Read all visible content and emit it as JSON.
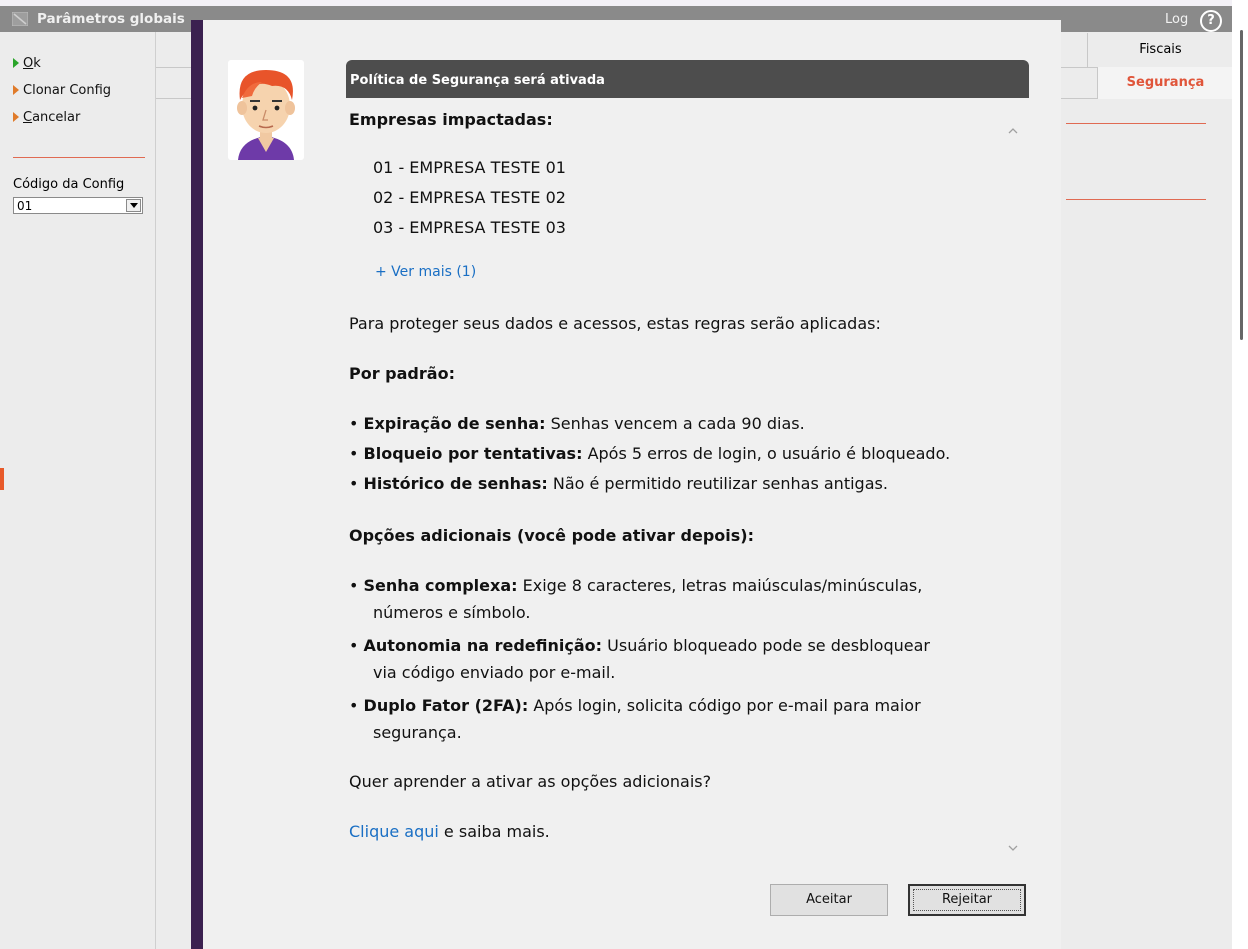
{
  "app": {
    "title": "Parâmetros globais",
    "log_label": "Log",
    "help_icon": "help-icon",
    "actions": [
      {
        "label": "Ok",
        "mnemonic": "O",
        "rest": "k",
        "icon": "green-triangle-icon"
      },
      {
        "label": "Clonar Config",
        "mnemonic": "",
        "rest": "Clonar Config",
        "icon": "orange-triangle-icon"
      },
      {
        "label": "Cancelar",
        "mnemonic": "C",
        "rest": "ancelar",
        "icon": "orange-triangle-icon"
      }
    ],
    "config_code_label": "Código da Config",
    "config_code_value": "01",
    "tabs": {
      "fiscais": "Fiscais",
      "seguranca": "Segurança"
    }
  },
  "dialog": {
    "title": "Política de Segurança será ativada",
    "companies_heading": "Empresas impactadas:",
    "companies": [
      "01 - EMPRESA TESTE 01",
      "02 - EMPRESA TESTE 02",
      "03 - EMPRESA TESTE 03"
    ],
    "see_more": "+ Ver mais (1)",
    "intro": "Para proteger seus dados e acessos, estas regras serão aplicadas:",
    "default_heading": "Por padrão:",
    "default_rules": [
      {
        "term": "Expiração de senha:",
        "text": "Senhas vencem a cada 90 dias."
      },
      {
        "term": "Bloqueio por tentativas:",
        "text": "Após 5 erros de login, o usuário é bloqueado."
      },
      {
        "term": "Histórico de senhas:",
        "text": "Não é permitido reutilizar senhas antigas."
      }
    ],
    "optional_heading": "Opções adicionais (você pode ativar depois):",
    "optional_rules": [
      {
        "term": "Senha complexa:",
        "text": "Exige 8 caracteres, letras maiúsculas/minúsculas,",
        "text2": "números e símbolo."
      },
      {
        "term": "Autonomia na redefinição:",
        "text": "Usuário bloqueado pode se desbloquear",
        "text2": "via código enviado por e-mail."
      },
      {
        "term": "Duplo Fator (2FA):",
        "text": "Após login, solicita código por e-mail para maior",
        "text2": "segurança."
      }
    ],
    "learn_question": "Quer aprender a ativar as opções adicionais?",
    "click_here": "Clique aqui",
    "learn_suffix": " e saiba mais.",
    "accept_label": "Aceitar",
    "reject_label": "Rejeitar"
  },
  "colors": {
    "dialog_header": "#4d4d4d",
    "dialog_strip": "#3b2150",
    "link": "#1a6fc4",
    "accent": "#e0553a",
    "titlebar": "#8a8a8a"
  }
}
